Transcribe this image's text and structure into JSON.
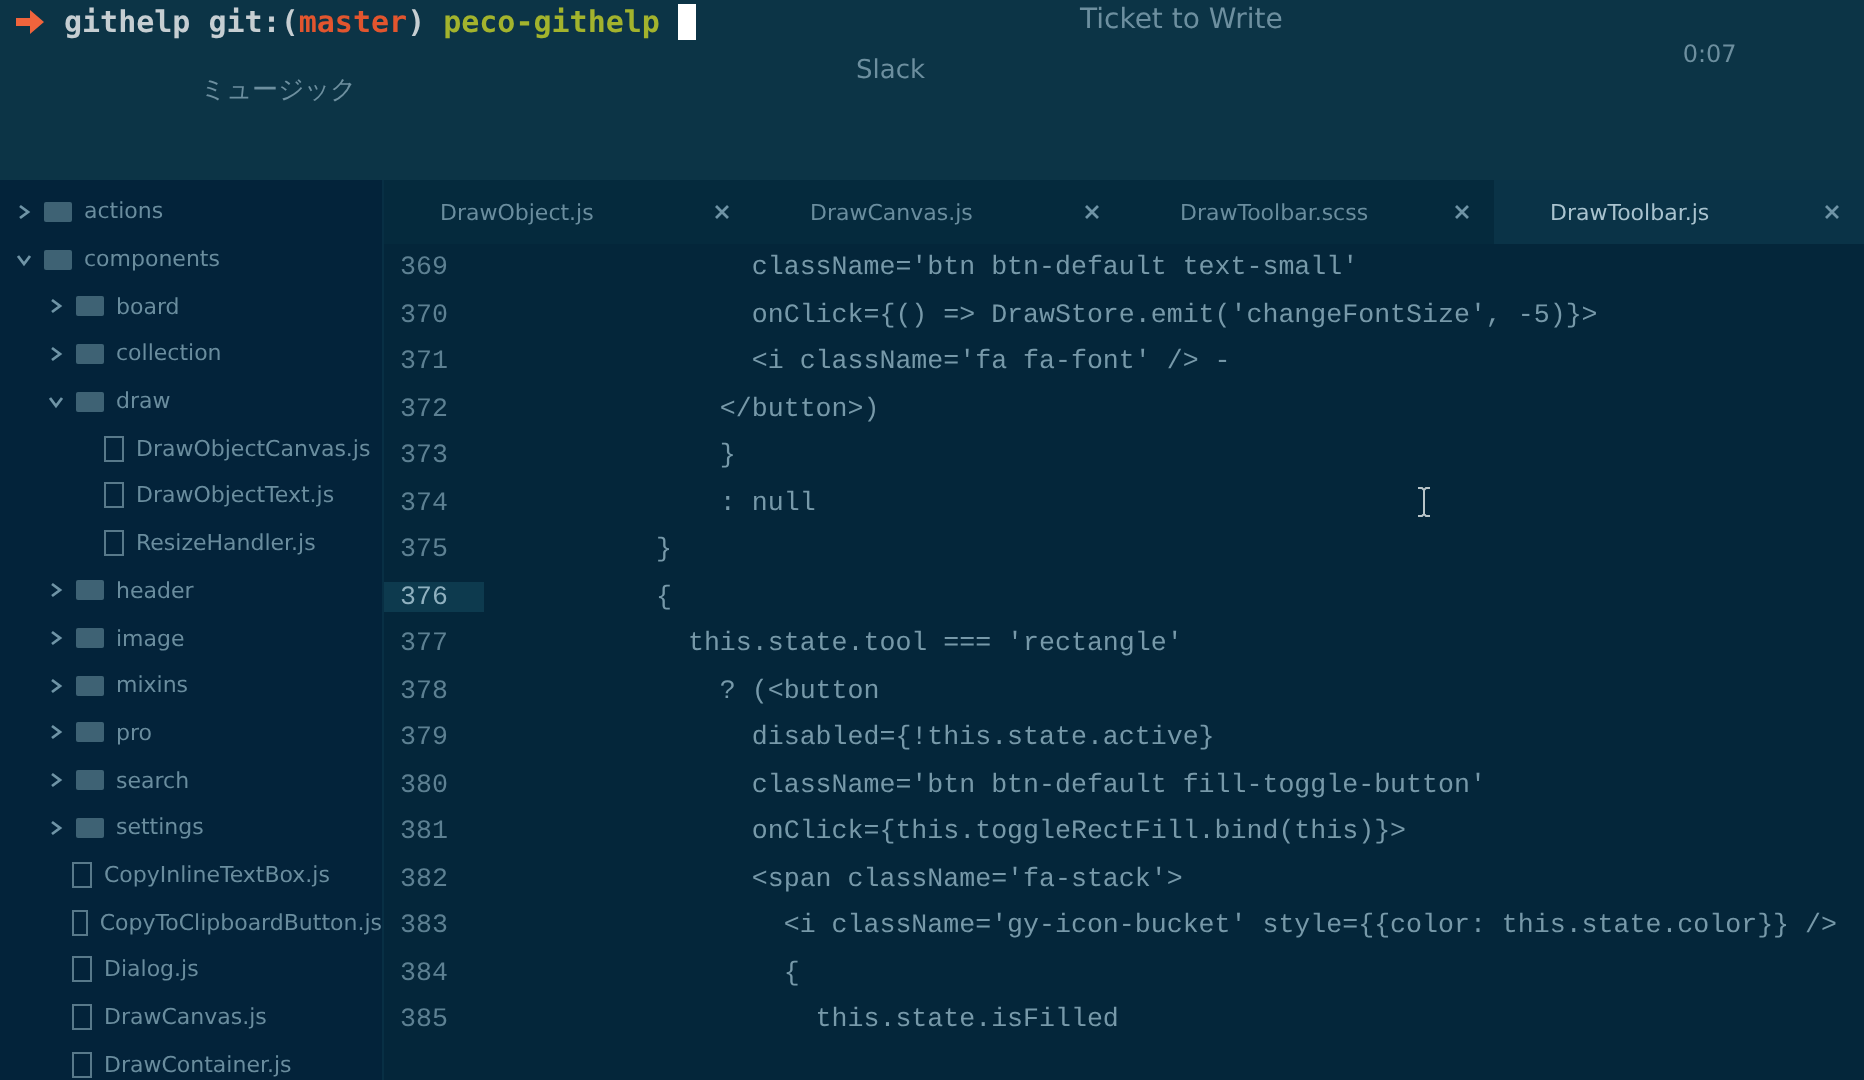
{
  "terminal": {
    "directory": "githelp",
    "branch_prefix": "git:(",
    "branch": "master",
    "branch_suffix": ")",
    "command": "peco-githelp"
  },
  "player": {
    "title": "Ticket to Write",
    "subtitle": "Slack",
    "time": "0:07",
    "section": "ミュージック"
  },
  "sidebar": {
    "items": [
      {
        "name": "actions",
        "kind": "folder",
        "expanded": false
      },
      {
        "name": "components",
        "kind": "folder",
        "expanded": true,
        "children": [
          {
            "name": "board",
            "kind": "folder",
            "expanded": false
          },
          {
            "name": "collection",
            "kind": "folder",
            "expanded": false
          },
          {
            "name": "draw",
            "kind": "folder",
            "expanded": true,
            "children": [
              {
                "name": "DrawObjectCanvas.js",
                "kind": "file"
              },
              {
                "name": "DrawObjectText.js",
                "kind": "file"
              },
              {
                "name": "ResizeHandler.js",
                "kind": "file"
              }
            ]
          },
          {
            "name": "header",
            "kind": "folder",
            "expanded": false
          },
          {
            "name": "image",
            "kind": "folder",
            "expanded": false
          },
          {
            "name": "mixins",
            "kind": "folder",
            "expanded": false
          },
          {
            "name": "pro",
            "kind": "folder",
            "expanded": false
          },
          {
            "name": "search",
            "kind": "folder",
            "expanded": false
          },
          {
            "name": "settings",
            "kind": "folder",
            "expanded": false
          },
          {
            "name": "CopyInlineTextBox.js",
            "kind": "file"
          },
          {
            "name": "CopyToClipboardButton.js",
            "kind": "file"
          },
          {
            "name": "Dialog.js",
            "kind": "file"
          },
          {
            "name": "DrawCanvas.js",
            "kind": "file"
          },
          {
            "name": "DrawContainer.js",
            "kind": "file"
          }
        ]
      }
    ]
  },
  "tabs": [
    {
      "label": "DrawObject.js",
      "selected": false
    },
    {
      "label": "DrawCanvas.js",
      "selected": false
    },
    {
      "label": "DrawToolbar.scss",
      "selected": false
    },
    {
      "label": "DrawToolbar.js",
      "selected": true
    }
  ],
  "lines": [
    {
      "number": "369",
      "text": "      className='btn btn-default text-small'",
      "current": false
    },
    {
      "number": "370",
      "text": "      onClick={() => DrawStore.emit('changeFontSize', -5)}>",
      "current": false
    },
    {
      "number": "371",
      "text": "      <i className='fa fa-font' /> -",
      "current": false
    },
    {
      "number": "372",
      "text": "    </button>)",
      "current": false
    },
    {
      "number": "373",
      "text": "    }",
      "current": false
    },
    {
      "number": "374",
      "text": "    : null",
      "current": false
    },
    {
      "number": "375",
      "text": "}",
      "current": false
    },
    {
      "number": "376",
      "text": "{",
      "current": true
    },
    {
      "number": "377",
      "text": "  this.state.tool === 'rectangle'",
      "current": false
    },
    {
      "number": "378",
      "text": "    ? (<button",
      "current": false
    },
    {
      "number": "379",
      "text": "      disabled={!this.state.active}",
      "current": false
    },
    {
      "number": "380",
      "text": "      className='btn btn-default fill-toggle-button'",
      "current": false
    },
    {
      "number": "381",
      "text": "      onClick={this.toggleRectFill.bind(this)}>",
      "current": false
    },
    {
      "number": "382",
      "text": "      <span className='fa-stack'>",
      "current": false
    },
    {
      "number": "383",
      "text": "        <i className='gy-icon-bucket' style={{color: this.state.color}} />",
      "current": false
    },
    {
      "number": "384",
      "text": "        {",
      "current": false
    },
    {
      "number": "385",
      "text": "          this.state.isFilled",
      "current": false
    }
  ]
}
